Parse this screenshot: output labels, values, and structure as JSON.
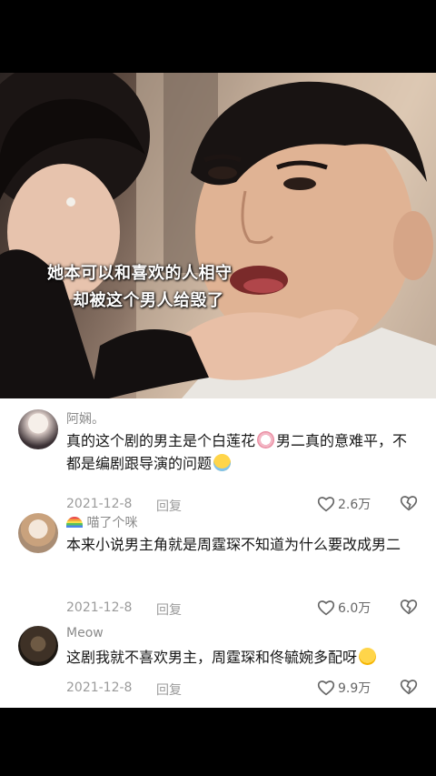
{
  "video": {
    "subtitle_line1": "她本可以和喜欢的人相守",
    "subtitle_line2": "却被这个男人给毁了"
  },
  "comments": [
    {
      "username": "阿娴。",
      "text_part1": "真的这个剧的男主是个白莲花",
      "emoji1": "flower-face-emoji",
      "text_part2": "男二真的意难平，不都是编剧跟导演的问题",
      "emoji2": "crying-face-emoji",
      "date": "2021-12-8",
      "reply_label": "回复",
      "likes": "2.6万"
    },
    {
      "username_prefix_icon": "rainbow-emoji",
      "username": "喵了个咪",
      "text": "本来小说男主角就是周霆琛不知道为什么要改成男二",
      "date": "2021-12-8",
      "reply_label": "回复",
      "likes": "6.0万"
    },
    {
      "username": "Meow",
      "text_part1": "这剧我就不喜欢男主，周霆琛和佟毓婉多配呀",
      "emoji1": "pleading-face-emoji",
      "date": "2021-12-8",
      "reply_label": "回复",
      "likes": "9.9万"
    }
  ]
}
